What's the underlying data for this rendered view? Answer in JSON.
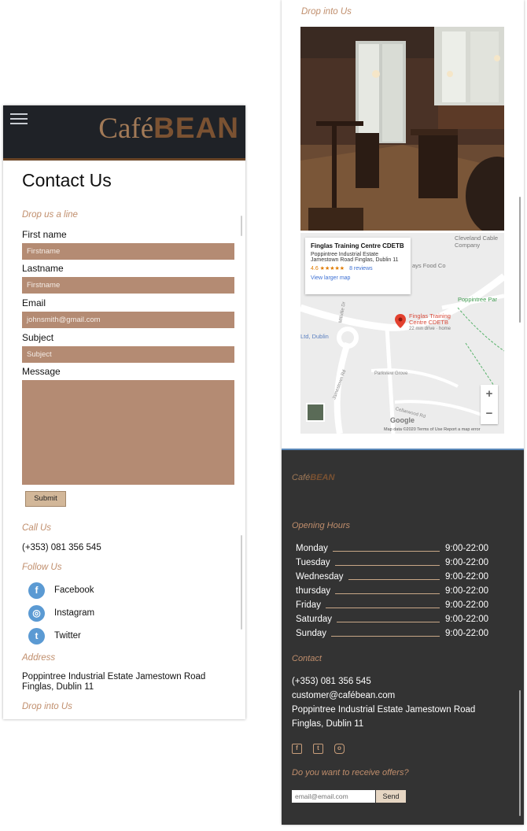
{
  "colors": {
    "header_bg": "#1f2227",
    "accent": "#c08e6c",
    "field_bg": "#b48b73",
    "footer_bg": "#333333",
    "social_blue": "#5b9ad3"
  },
  "brand": {
    "cafe": "Café",
    "bean": "BEAN"
  },
  "left": {
    "title": "Contact Us",
    "drop_line": "Drop us a line",
    "form": {
      "first_name_label": "First name",
      "first_name_placeholder": "Firstname",
      "last_name_label": "Lastname",
      "last_name_placeholder": "Firstname",
      "email_label": "Email",
      "email_placeholder": "johnsmith@gmail.com",
      "subject_label": "Subject",
      "subject_placeholder": "Subject",
      "message_label": "Message",
      "submit": "Submit"
    },
    "call_us": "Call Us",
    "phone": "(+353) 081 356 545",
    "follow_us": "Follow Us",
    "socials": [
      {
        "label": "Facebook",
        "icon": "facebook-icon",
        "glyph": "f"
      },
      {
        "label": "Instagram",
        "icon": "instagram-icon",
        "glyph": "◎"
      },
      {
        "label": "Twitter",
        "icon": "twitter-icon",
        "glyph": "t"
      }
    ],
    "address_label": "Address",
    "address": "Poppintree Industrial Estate Jamestown Road Finglas, Dublin 11",
    "drop_into": "Drop into Us"
  },
  "right": {
    "drop_into": "Drop into Us",
    "map": {
      "place_name": "Finglas Training Centre CDETB",
      "place_address": "Poppintree Industrial Estate Jamestown Road Finglas, Dublin 11",
      "rating": "4.6 ★★★★★",
      "reviews": "8 reviews",
      "view_larger": "View larger map",
      "pin_label": "Finglas Training Centre CDETB",
      "pin_sub": "22 min drive · home",
      "labels": [
        "Cleveland Cable Company",
        "ays Food Co",
        "Poppintree Par",
        "Ltd, Dublin",
        "Parkview Grove",
        "Jamestown Rd",
        "Millville Dr",
        "Cellarwood Rd"
      ],
      "zoom_in": "+",
      "zoom_out": "−",
      "google": "Google",
      "footer": "Map data ©2020   Terms of Use   Report a map error"
    },
    "footer": {
      "opening_hours": "Opening Hours",
      "hours": [
        {
          "day": "Monday",
          "time": "9:00-22:00"
        },
        {
          "day": "Tuesday",
          "time": "9:00-22:00"
        },
        {
          "day": "Wednesday",
          "time": "9:00-22:00"
        },
        {
          "day": "thursday",
          "time": "9:00-22:00"
        },
        {
          "day": "Friday",
          "time": "9:00-22:00"
        },
        {
          "day": "Saturday",
          "time": "9:00-22:00"
        },
        {
          "day": "Sunday",
          "time": "9:00-22:00"
        }
      ],
      "contact": "Contact",
      "phone": "(+353) 081 356 545",
      "email": "customer@cafébean.com",
      "address_line1": "Poppintree Industrial Estate Jamestown Road",
      "address_line2": "Finglas, Dublin 11",
      "offers": "Do you want to receive offers?",
      "email_placeholder": "email@email.com",
      "send": "Send"
    }
  }
}
